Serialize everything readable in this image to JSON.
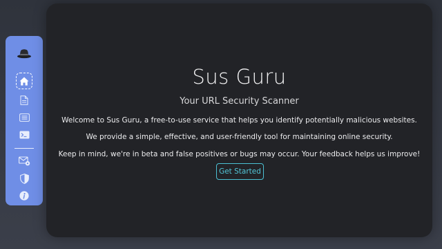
{
  "sidebar": {
    "items": [
      {
        "icon": "hat-logo-icon"
      },
      {
        "icon": "home-icon",
        "active": true
      },
      {
        "icon": "document-icon"
      },
      {
        "icon": "list-icon"
      },
      {
        "icon": "terminal-icon"
      },
      {
        "icon": "mail-settings-icon"
      },
      {
        "icon": "shield-icon"
      },
      {
        "icon": "info-icon"
      }
    ],
    "accent_color": "#6f8ee6"
  },
  "main": {
    "title": "Sus Guru",
    "subtitle": "Your URL Security Scanner",
    "paragraphs": [
      "Welcome to Sus Guru, a free-to-use service that helps you identify potentially malicious websites.",
      "We provide a simple, effective, and user-friendly tool for maintaining online security.",
      "Keep in mind, we're in beta and false positives or bugs may occur. Your feedback helps us improve!"
    ],
    "cta_label": "Get Started",
    "cta_color": "#4cc1d4",
    "panel_color": "#222327"
  }
}
